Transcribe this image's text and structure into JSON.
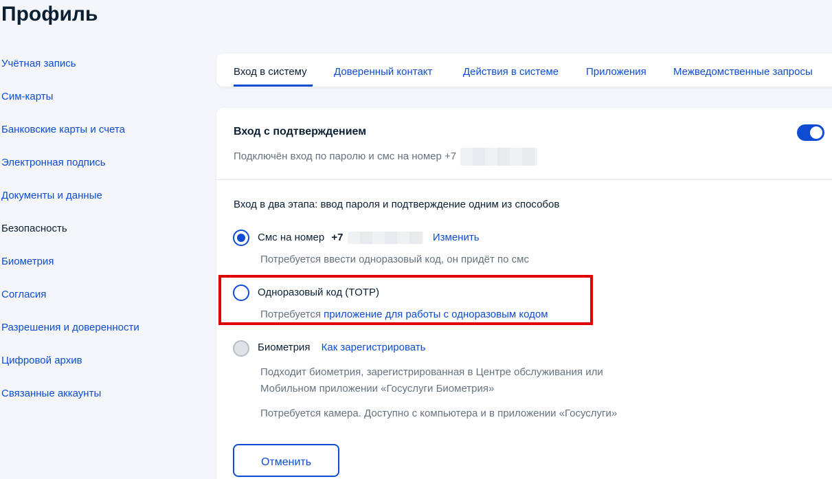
{
  "page": {
    "title": "Профиль"
  },
  "sidebar": {
    "items": [
      {
        "label": "Учётная запись"
      },
      {
        "label": "Сим-карты"
      },
      {
        "label": "Банковские карты и счета"
      },
      {
        "label": "Электронная подпись"
      },
      {
        "label": "Документы и данные"
      },
      {
        "label": "Безопасность",
        "active": true
      },
      {
        "label": "Биометрия"
      },
      {
        "label": "Согласия"
      },
      {
        "label": "Разрешения и доверенности"
      },
      {
        "label": "Цифровой архив"
      },
      {
        "label": "Связанные аккаунты"
      }
    ]
  },
  "tabs": [
    {
      "label": "Вход в систему",
      "active": true
    },
    {
      "label": "Доверенный контакт"
    },
    {
      "label": "Действия в системе"
    },
    {
      "label": "Приложения"
    },
    {
      "label": "Межведомственные запросы"
    }
  ],
  "card": {
    "title": "Вход с подтверждением",
    "subtitle": "Подключён вход по паролю и смс на номер +7",
    "toggle_on": true,
    "section_label": "Вход в два этапа: ввод пароля и подтверждение одним из способов"
  },
  "options": {
    "sms": {
      "label": "Смс на номер",
      "phone_prefix": "+7",
      "change_link": "Изменить",
      "hint": "Потребуется ввести одноразовый код, он придёт по смс",
      "selected": true
    },
    "totp": {
      "label": "Одноразовый код (TOTP)",
      "hint_prefix": "Потребуется",
      "hint_link": "приложение для работы с одноразовым кодом",
      "selected": false
    },
    "biometry": {
      "label": "Биометрия",
      "register_link": "Как зарегистрировать",
      "hint_line1": "Подходит биометрия, зарегистрированная в Центре обслуживания или",
      "hint_line2": "Мобильном приложении «Госуслуги Биометрия»",
      "hint_camera": "Потребуется камера. Доступно с компьютера и в приложении «Госуслуги»",
      "disabled": true
    }
  },
  "buttons": {
    "cancel": "Отменить"
  },
  "colors": {
    "accent": "#0d4cd3",
    "highlight": "#e00000",
    "text": "#0b1f33",
    "muted": "#66727f"
  }
}
